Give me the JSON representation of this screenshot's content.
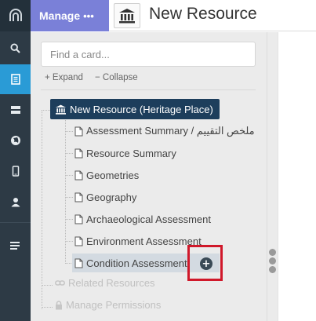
{
  "manage": {
    "label": "Manage",
    "dots": "•••"
  },
  "header": {
    "title": "New Resource"
  },
  "search": {
    "placeholder": "Find a card..."
  },
  "tree_controls": {
    "expand": "Expand",
    "collapse": "Collapse",
    "expand_symbol": "+",
    "collapse_symbol": "−"
  },
  "tree": {
    "root": "New Resource (Heritage Place)",
    "children": [
      "Assessment Summary / ملخص التقييم",
      "Resource Summary",
      "Geometries",
      "Geography",
      "Archaeological Assessment",
      "Environment Assessment",
      "Condition Assessment"
    ],
    "add_symbol": "+",
    "disabled": [
      "Related Resources",
      "Manage Permissions"
    ]
  },
  "colors": {
    "rail": "#2d3a45",
    "active": "#2a9bd6",
    "manage": "#7a80d8",
    "root": "#1d3e5c",
    "highlight_box": "#d0182a"
  },
  "icons": [
    "logo-icon",
    "search-icon",
    "resource-editor-icon",
    "database-icon",
    "globe-icon",
    "mobile-icon",
    "user-icon",
    "list-icon",
    "museum-icon",
    "file-icon",
    "add-circle-icon",
    "link-icon",
    "lock-icon"
  ]
}
